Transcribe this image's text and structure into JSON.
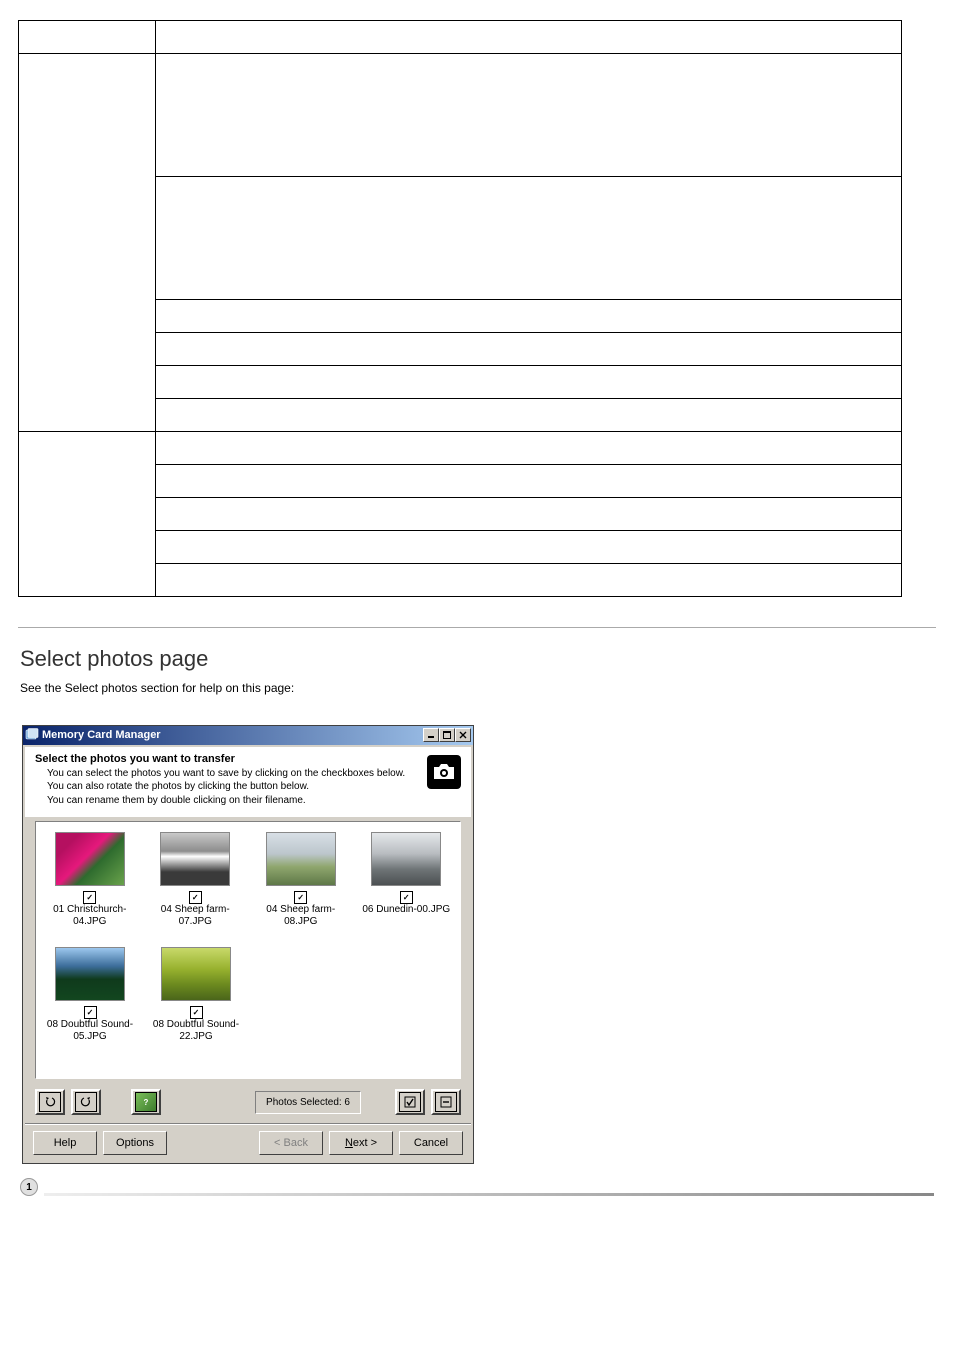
{
  "dialog": {
    "title": "Memory Card Manager",
    "banner_heading": "Select the photos you want to transfer",
    "banner_line1": "You can select the photos you want to save by clicking on the checkboxes below.",
    "banner_line2": "You can also rotate the photos by clicking the button below.",
    "banner_line3": "You can rename them by double clicking on their filename.",
    "photos": [
      {
        "name": "01 Christchurch-04.JPG",
        "checked": true,
        "grad": "linear-gradient(135deg,#b51060 20%,#e6187c 45%,#2e6b2e 60%,#69a24b 100%)"
      },
      {
        "name": "04 Sheep farm-07.JPG",
        "checked": true,
        "grad": "linear-gradient(180deg,#c9c9c9 0%,#8d8d8d 35%,#fff 45%,#3a3a3a 75%)"
      },
      {
        "name": "04 Sheep farm-08.JPG",
        "checked": true,
        "grad": "linear-gradient(180deg,#d8dfe6 0%,#bcc6cc 40%,#8fa66d 65%,#5e7848 100%)"
      },
      {
        "name": "06 Dunedin-00.JPG",
        "checked": true,
        "grad": "linear-gradient(180deg,#e4e7ea 0%,#b8bcc0 40%,#6e7476 70%,#4c5052 100%)"
      },
      {
        "name": "08 Doubtful Sound-05.JPG",
        "checked": true,
        "grad": "linear-gradient(180deg,#9cc7ee 0%,#3c6d9a 35%,#0f3a1c 60%,#12461f 100%)"
      },
      {
        "name": "08 Doubtful Sound-22.JPG",
        "checked": true,
        "grad": "linear-gradient(180deg,#c8d96a 0%,#98b22f 40%,#6c8a1f 70%,#4a651a 100%)"
      }
    ],
    "status": "Photos Selected: 6",
    "buttons": {
      "help": "Help",
      "options": "Options",
      "back": "< Back",
      "next_prefix": "N",
      "next_rest": "ext >",
      "cancel": "Cancel"
    }
  },
  "section": {
    "title": "Select photos page",
    "body": "See the Select photos section for help on this page:"
  },
  "ref_num": "1"
}
